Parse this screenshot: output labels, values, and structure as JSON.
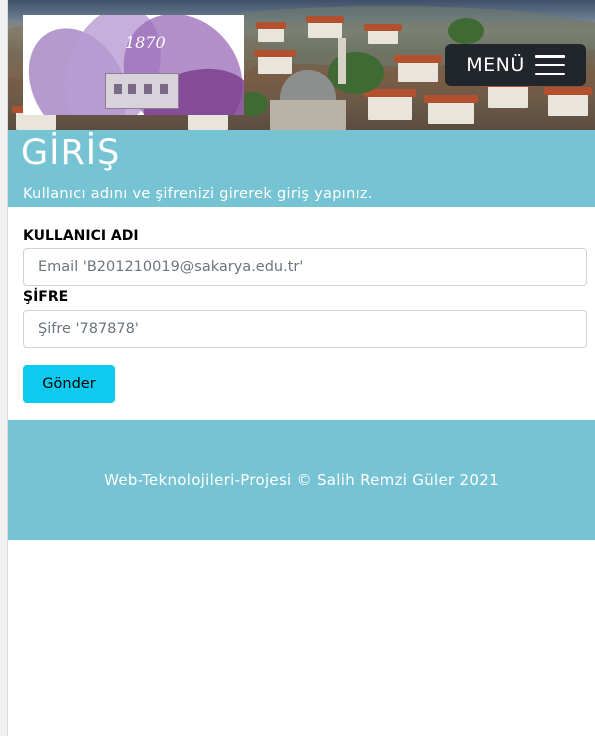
{
  "header": {
    "logo_year": "1870",
    "menu_label": "MENÜ"
  },
  "hero": {
    "title": "GİRİŞ",
    "subtitle": "Kullanıcı adını ve şifrenizi girerek giriş yapınız."
  },
  "form": {
    "username_label": "KULLANICI ADI",
    "username_placeholder": "Email 'B201210019@sakarya.edu.tr'",
    "username_value": "",
    "password_label": "ŞİFRE",
    "password_placeholder": "Şifre '787878'",
    "password_value": "",
    "submit_label": "Gönder"
  },
  "footer": {
    "text": "Web-Teknolojileri-Projesi © Salih Remzi Güler 2021"
  },
  "colors": {
    "accent": "#75c3d3",
    "button": "#0dcaf0",
    "menu_bg": "#20262b"
  },
  "icons": {
    "menu": "hamburger-icon"
  }
}
